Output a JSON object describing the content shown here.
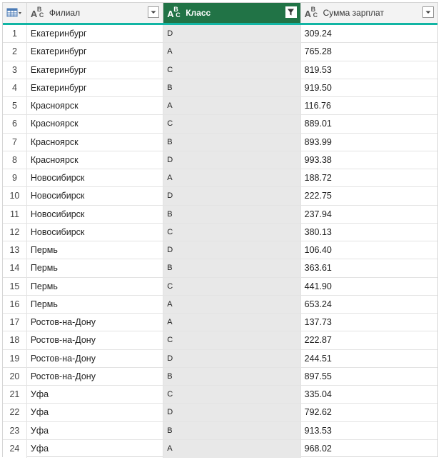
{
  "columns": {
    "col1": {
      "label": "Филиал",
      "type": "ABC"
    },
    "col2": {
      "label": "Класс",
      "type": "ABC",
      "filtered": true
    },
    "col3": {
      "label": "Сумма зарплат",
      "type": "ABC"
    }
  },
  "colors": {
    "selected_header": "#217346",
    "accent_bar": "#11b5a4"
  },
  "rows": [
    {
      "n": "1",
      "f": "Екатеринбург",
      "k": "D",
      "s": "309.24"
    },
    {
      "n": "2",
      "f": "Екатеринбург",
      "k": "A",
      "s": "765.28"
    },
    {
      "n": "3",
      "f": "Екатеринбург",
      "k": "C",
      "s": "819.53"
    },
    {
      "n": "4",
      "f": "Екатеринбург",
      "k": "B",
      "s": "919.50"
    },
    {
      "n": "5",
      "f": "Красноярск",
      "k": "A",
      "s": "116.76"
    },
    {
      "n": "6",
      "f": "Красноярск",
      "k": "C",
      "s": "889.01"
    },
    {
      "n": "7",
      "f": "Красноярск",
      "k": "B",
      "s": "893.99"
    },
    {
      "n": "8",
      "f": "Красноярск",
      "k": "D",
      "s": "993.38"
    },
    {
      "n": "9",
      "f": "Новосибирск",
      "k": "A",
      "s": "188.72"
    },
    {
      "n": "10",
      "f": "Новосибирск",
      "k": "D",
      "s": "222.75"
    },
    {
      "n": "11",
      "f": "Новосибирск",
      "k": "B",
      "s": "237.94"
    },
    {
      "n": "12",
      "f": "Новосибирск",
      "k": "C",
      "s": "380.13"
    },
    {
      "n": "13",
      "f": "Пермь",
      "k": "D",
      "s": "106.40"
    },
    {
      "n": "14",
      "f": "Пермь",
      "k": "B",
      "s": "363.61"
    },
    {
      "n": "15",
      "f": "Пермь",
      "k": "C",
      "s": "441.90"
    },
    {
      "n": "16",
      "f": "Пермь",
      "k": "A",
      "s": "653.24"
    },
    {
      "n": "17",
      "f": "Ростов-на-Дону",
      "k": "A",
      "s": "137.73"
    },
    {
      "n": "18",
      "f": "Ростов-на-Дону",
      "k": "C",
      "s": "222.87"
    },
    {
      "n": "19",
      "f": "Ростов-на-Дону",
      "k": "D",
      "s": "244.51"
    },
    {
      "n": "20",
      "f": "Ростов-на-Дону",
      "k": "B",
      "s": "897.55"
    },
    {
      "n": "21",
      "f": "Уфа",
      "k": "C",
      "s": "335.04"
    },
    {
      "n": "22",
      "f": "Уфа",
      "k": "D",
      "s": "792.62"
    },
    {
      "n": "23",
      "f": "Уфа",
      "k": "B",
      "s": "913.53"
    },
    {
      "n": "24",
      "f": "Уфа",
      "k": "A",
      "s": "968.02"
    }
  ]
}
